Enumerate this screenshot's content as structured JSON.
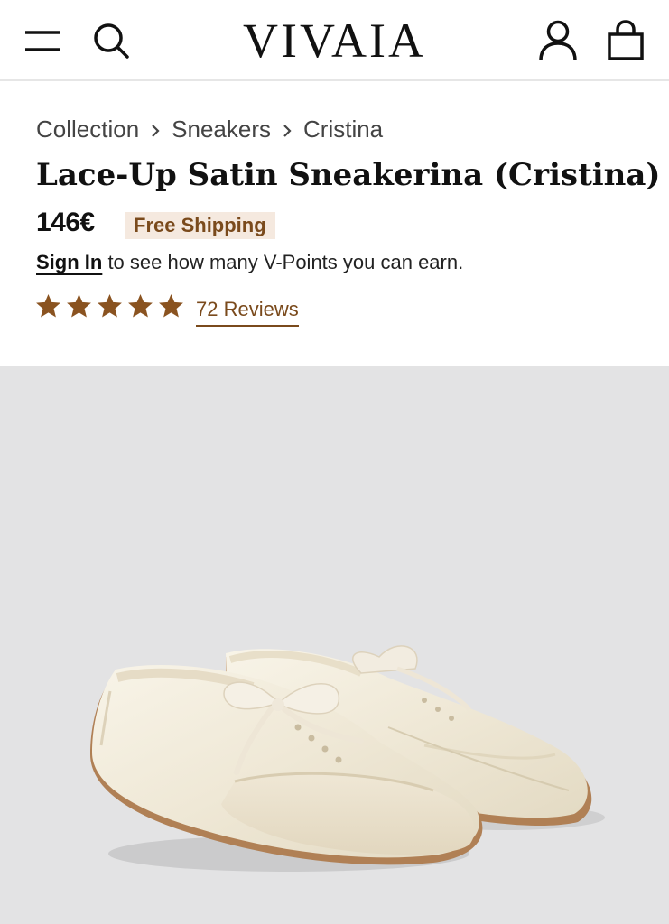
{
  "brand": {
    "logo_text": "VIVAIA"
  },
  "header": {
    "icons": [
      "menu-icon",
      "search-icon",
      "account-icon",
      "shopping-bag-icon"
    ]
  },
  "breadcrumb": {
    "items": [
      "Collection",
      "Sneakers",
      "Cristina"
    ]
  },
  "product": {
    "title": "Lace-Up Satin Sneakerina (Cristina)",
    "price": "146€",
    "shipping_badge": "Free Shipping",
    "signin_link": "Sign In",
    "signin_text": " to see how many V-Points you can earn.",
    "rating": 5,
    "rating_max": 5,
    "reviews_label": "72 Reviews"
  },
  "colors": {
    "accent_brown": "#7a4a1c",
    "star_color": "#8a5320",
    "badge_background": "#f5e9df",
    "gallery_background": "#e3e3e4"
  }
}
